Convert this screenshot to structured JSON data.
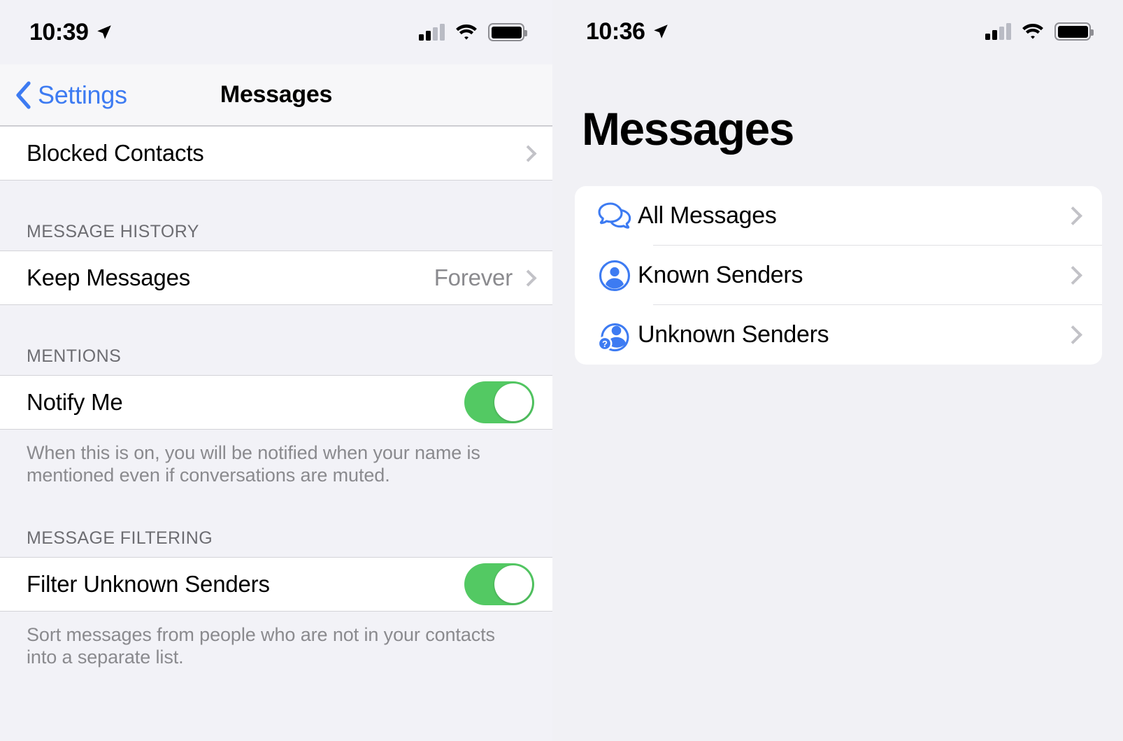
{
  "left_screen": {
    "status_bar": {
      "time": "10:39",
      "location_icon": "location-arrow-icon",
      "signal_icon": "cellular-signal-icon",
      "wifi_icon": "wifi-icon",
      "battery_icon": "battery-icon"
    },
    "nav": {
      "back_label": "Settings",
      "back_icon": "chevron-left-icon",
      "title": "Messages"
    },
    "rows": {
      "blocked_contacts": {
        "label": "Blocked Contacts",
        "chevron": "chevron-right-icon"
      },
      "keep_messages": {
        "label": "Keep Messages",
        "value": "Forever",
        "chevron": "chevron-right-icon"
      },
      "notify_me": {
        "label": "Notify Me",
        "toggle": "on"
      },
      "filter_unknown_senders": {
        "label": "Filter Unknown Senders",
        "toggle": "on"
      }
    },
    "sections": {
      "message_history": "MESSAGE HISTORY",
      "mentions": "MENTIONS",
      "message_filtering": "MESSAGE FILTERING"
    },
    "footnotes": {
      "mentions": "When this is on, you will be notified when your name is mentioned even if conversations are muted.",
      "filtering": "Sort messages from people who are not in your contacts into a separate list."
    }
  },
  "right_screen": {
    "status_bar": {
      "time": "10:36",
      "location_icon": "location-arrow-icon",
      "signal_icon": "cellular-signal-icon",
      "wifi_icon": "wifi-icon",
      "battery_icon": "battery-icon"
    },
    "title": "Messages",
    "list": [
      {
        "label": "All Messages",
        "icon": "speech-bubbles-icon",
        "chevron": "chevron-right-icon"
      },
      {
        "label": "Known Senders",
        "icon": "person-circle-icon",
        "chevron": "chevron-right-icon"
      },
      {
        "label": "Unknown Senders",
        "icon": "person-question-icon",
        "chevron": "chevron-right-icon"
      }
    ]
  },
  "colors": {
    "accent_blue": "#3d7bf2",
    "toggle_green": "#53c963",
    "icon_blue": "#3d7bf2",
    "background": "#f2f2f7",
    "cell_background": "#ffffff",
    "secondary_text": "#8a8a8e"
  }
}
